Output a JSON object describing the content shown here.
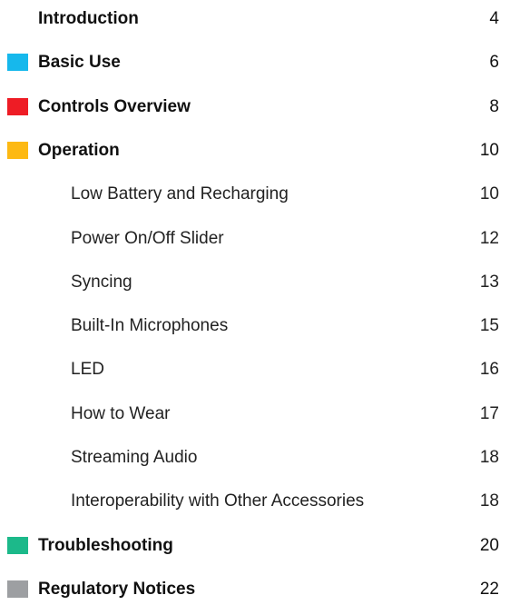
{
  "toc": {
    "introduction": {
      "title": "Introduction",
      "page": "4"
    },
    "basic_use": {
      "title": "Basic Use",
      "page": "6",
      "color": "#16b8ec"
    },
    "controls_overview": {
      "title": "Controls Overview",
      "page": "8",
      "color": "#ee1c25"
    },
    "operation": {
      "title": "Operation",
      "page": "10",
      "color": "#fdb913",
      "subsections": [
        {
          "title": "Low Battery and Recharging",
          "page": "10"
        },
        {
          "title": "Power On/Off Slider",
          "page": "12"
        },
        {
          "title": "Syncing",
          "page": "13"
        },
        {
          "title": "Built-In Microphones",
          "page": "15"
        },
        {
          "title": "LED",
          "page": "16"
        },
        {
          "title": "How to Wear",
          "page": "17"
        },
        {
          "title": "Streaming Audio",
          "page": "18"
        },
        {
          "title": "Interoperability with Other Accessories",
          "page": "18"
        }
      ]
    },
    "troubleshooting": {
      "title": "Troubleshooting",
      "page": "20",
      "color": "#1cb98a"
    },
    "regulatory_notices": {
      "title": "Regulatory Notices",
      "page": "22",
      "color": "#9d9fa2"
    }
  }
}
